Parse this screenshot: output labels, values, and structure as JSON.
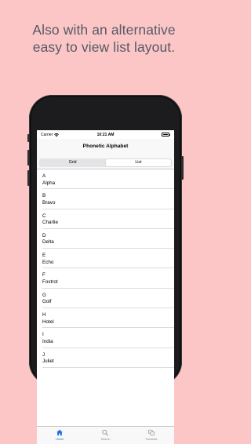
{
  "headline": {
    "line1": "Also with an alternative",
    "line2": "easy to view list layout."
  },
  "status_bar": {
    "carrier": "Carrier",
    "time": "10:21 AM"
  },
  "nav": {
    "title": "Phonetic Alphabet"
  },
  "segmented": {
    "options": [
      "Grid",
      "List"
    ],
    "selected": "List"
  },
  "list": {
    "rows": [
      {
        "letter": "A",
        "word": "Alpha"
      },
      {
        "letter": "B",
        "word": "Bravo"
      },
      {
        "letter": "C",
        "word": "Charlie"
      },
      {
        "letter": "D",
        "word": "Delta"
      },
      {
        "letter": "E",
        "word": "Echo"
      },
      {
        "letter": "F",
        "word": "Foxtrot"
      },
      {
        "letter": "G",
        "word": "Golf"
      },
      {
        "letter": "H",
        "word": "Hotel"
      },
      {
        "letter": "I",
        "word": "India"
      },
      {
        "letter": "J",
        "word": "Juliet"
      }
    ]
  },
  "tab_bar": {
    "items": [
      {
        "label": "Home",
        "icon": "home-icon",
        "active": true
      },
      {
        "label": "Search",
        "icon": "search-icon",
        "active": false
      },
      {
        "label": "Translate",
        "icon": "translate-icon",
        "active": false
      }
    ]
  },
  "colors": {
    "background": "#fcc6c6",
    "headline_text": "#555a66",
    "accent": "#1f6fe5"
  }
}
